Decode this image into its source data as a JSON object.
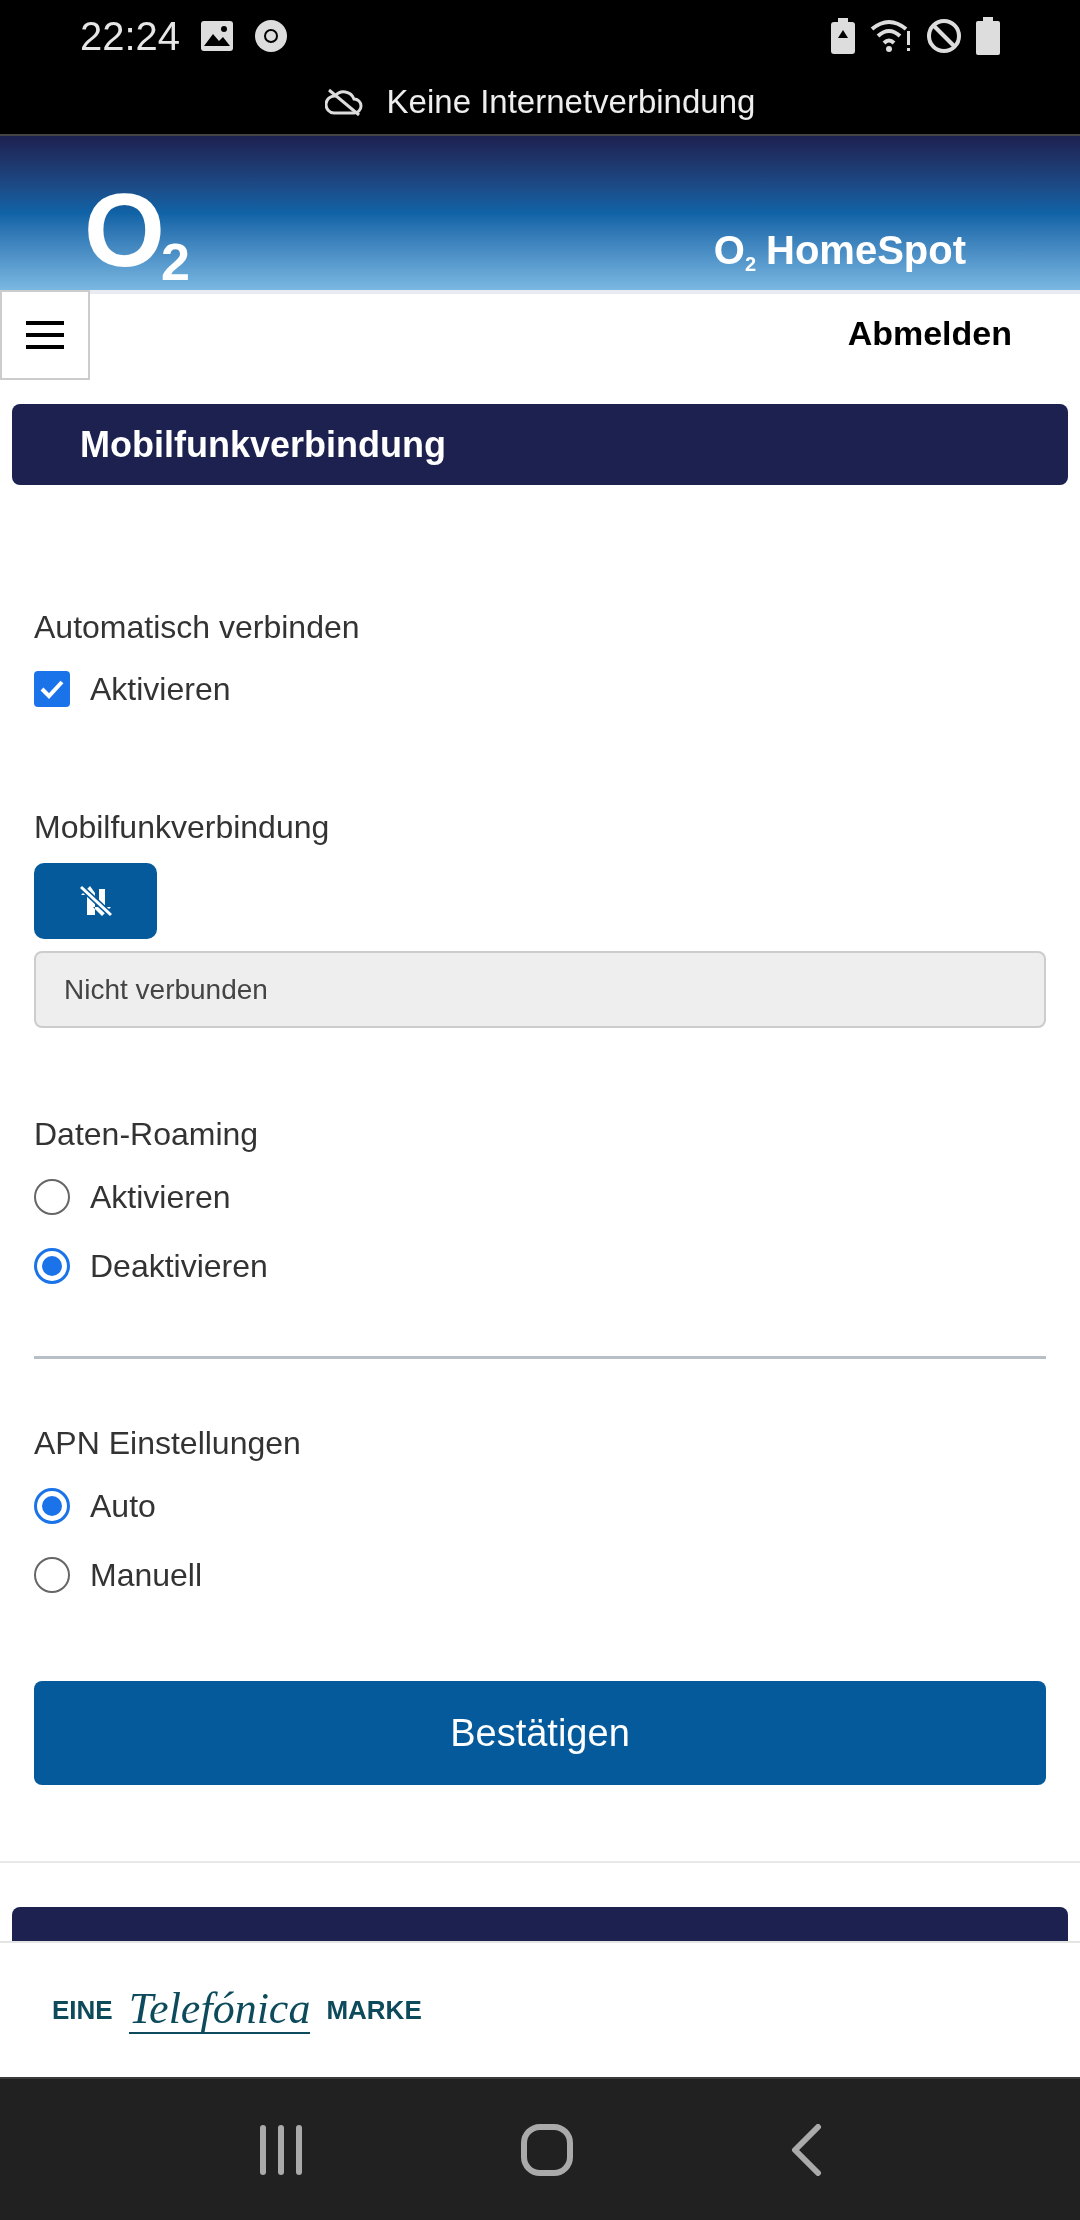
{
  "status_bar": {
    "time": "22:24",
    "notification": "Keine Internetverbindung"
  },
  "header": {
    "logo": {
      "letter": "O",
      "subscript": "2"
    },
    "product": {
      "letter": "O",
      "subscript": "2",
      "name": "HomeSpot"
    },
    "logout": "Abmelden"
  },
  "section": {
    "title": "Mobilfunkverbindung",
    "auto_connect": {
      "label": "Automatisch verbinden",
      "option": {
        "label": "Aktivieren",
        "checked": true
      }
    },
    "connection": {
      "label": "Mobilfunkverbindung",
      "status": "Nicht verbunden"
    },
    "roaming": {
      "label": "Daten-Roaming",
      "options": [
        {
          "label": "Aktivieren",
          "selected": false
        },
        {
          "label": "Deaktivieren",
          "selected": true
        }
      ]
    },
    "apn": {
      "label": "APN Einstellungen",
      "options": [
        {
          "label": "Auto",
          "selected": true
        },
        {
          "label": "Manuell",
          "selected": false
        }
      ]
    },
    "confirm": "Bestätigen"
  },
  "footer": {
    "prefix": "EINE",
    "brand": "Telefónica",
    "suffix": "MARKE"
  }
}
